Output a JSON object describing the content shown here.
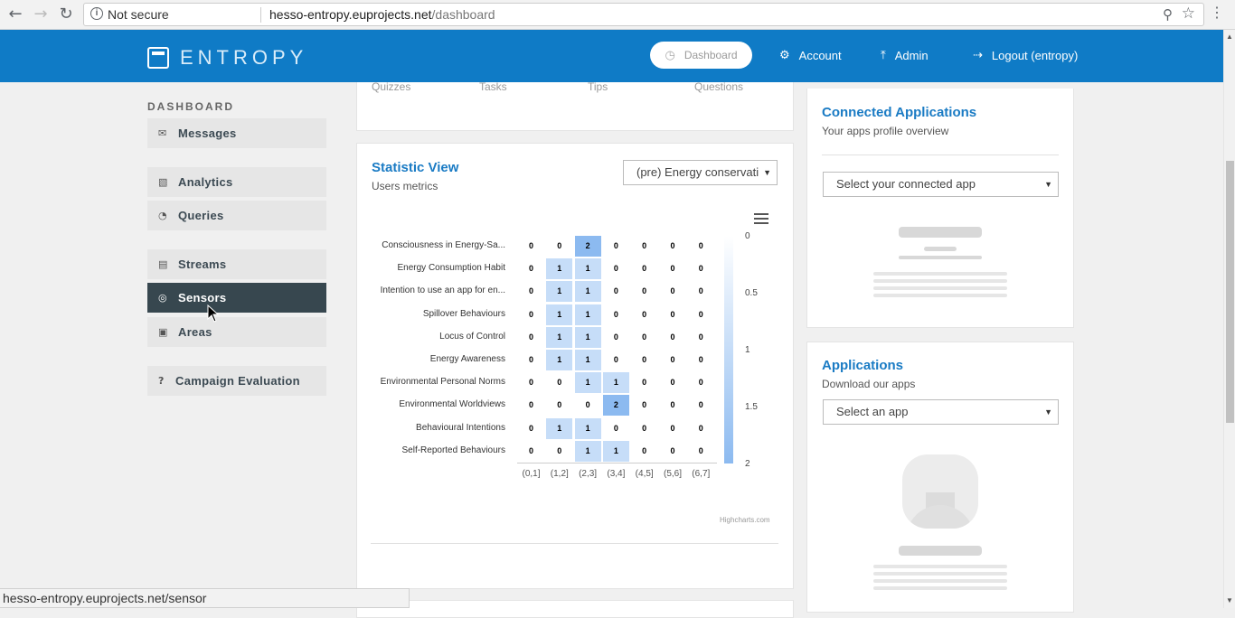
{
  "browser": {
    "security_label": "Not secure",
    "url_host": "hesso-entropy.euprojects.net",
    "url_path": "/dashboard",
    "status_url": "hesso-entropy.euprojects.net/sensor"
  },
  "header": {
    "logo_text": "ENTROPY",
    "nav": {
      "dashboard": "Dashboard",
      "account": "Account",
      "admin": "Admin",
      "logout": "Logout (entropy)"
    }
  },
  "sidebar": {
    "heading": "DASHBOARD",
    "items": [
      {
        "label": "Messages",
        "icon": "envelope-open-icon"
      },
      {
        "label": "Analytics",
        "icon": "bar-chart-icon"
      },
      {
        "label": "Queries",
        "icon": "pie-chart-icon"
      },
      {
        "label": "Streams",
        "icon": "list-icon"
      },
      {
        "label": "Sensors",
        "icon": "target-icon",
        "active": true
      },
      {
        "label": "Areas",
        "icon": "map-icon"
      },
      {
        "label": "Campaign Evaluation",
        "icon": "question-icon"
      }
    ]
  },
  "top_card": {
    "labels": [
      "Quizzes",
      "Tasks",
      "Tips",
      "Questions"
    ]
  },
  "statistic": {
    "title": "Statistic View",
    "subtitle": "Users metrics",
    "selected_option": "(pre) Energy conservati",
    "credits": "Highcharts.com"
  },
  "chart_data": {
    "type": "heatmap",
    "title": "",
    "categories_x": [
      "(0,1]",
      "(1,2]",
      "(2,3]",
      "(3,4]",
      "(4,5]",
      "(5,6]",
      "(6,7]"
    ],
    "categories_y": [
      "Consciousness in Energy-Sa...",
      "Energy Consumption Habit",
      "Intention to use an app for en...",
      "Spillover Behaviours",
      "Locus of Control",
      "Energy Awareness",
      "Environmental Personal Norms",
      "Environmental Worldviews",
      "Behavioural Intentions",
      "Self-Reported Behaviours"
    ],
    "values": [
      [
        0,
        0,
        2,
        0,
        0,
        0,
        0
      ],
      [
        0,
        1,
        1,
        0,
        0,
        0,
        0
      ],
      [
        0,
        1,
        1,
        0,
        0,
        0,
        0
      ],
      [
        0,
        1,
        1,
        0,
        0,
        0,
        0
      ],
      [
        0,
        1,
        1,
        0,
        0,
        0,
        0
      ],
      [
        0,
        1,
        1,
        0,
        0,
        0,
        0
      ],
      [
        0,
        0,
        1,
        1,
        0,
        0,
        0
      ],
      [
        0,
        0,
        0,
        2,
        0,
        0,
        0
      ],
      [
        0,
        1,
        1,
        0,
        0,
        0,
        0
      ],
      [
        0,
        0,
        1,
        1,
        0,
        0,
        0
      ]
    ],
    "color_axis": {
      "min": 0,
      "max": 2,
      "ticks": [
        "0",
        "0.5",
        "1",
        "1.5",
        "2"
      ],
      "min_color": "#ffffff",
      "max_color": "#8cbaf0"
    },
    "grid": false
  },
  "connected_apps": {
    "title": "Connected Applications",
    "subtitle": "Your apps profile overview",
    "select_placeholder": "Select your connected app"
  },
  "applications": {
    "title": "Applications",
    "subtitle": "Download our apps",
    "select_placeholder": "Select an app"
  }
}
